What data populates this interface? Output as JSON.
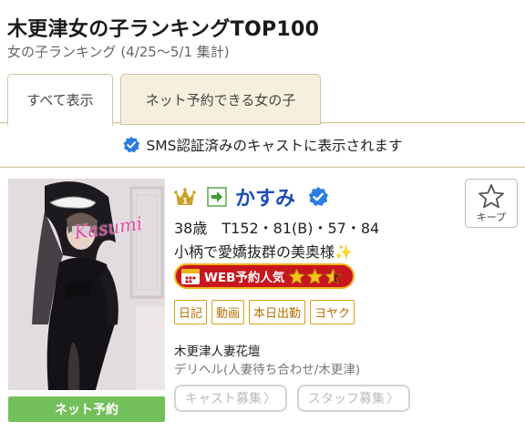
{
  "header": {
    "title": "木更津女の子ランキングTOP100",
    "subtitle": "女の子ランキング (4/25〜5/1 集計)"
  },
  "tabs": [
    {
      "label": "すべて表示",
      "active": true
    },
    {
      "label": "ネット予約できる女の子",
      "active": false
    }
  ],
  "notice": "SMS認証済みのキャストに表示されます",
  "cast": {
    "rank": 1,
    "name": "かすみ",
    "photo_signature": "Kasumi",
    "stats": "38歳　T152・81(B)・57・84",
    "catchphrase": "小柄で愛嬌抜群の美奥様",
    "sparkle": "✨",
    "web_badge": "WEB予約人気",
    "web_rating": 2.5,
    "tags": [
      "日記",
      "動画",
      "本日出勤",
      "ヨヤク"
    ],
    "shop_name": "木更津人妻花壇",
    "shop_type": "デリヘル(人妻待ち合わせ/木更津)",
    "keep_label": "キープ",
    "net_reserve_label": "ネット予約",
    "recruit_cast_label": "キャスト募集",
    "recruit_staff_label": "スタッフ募集",
    "chevron": "〉"
  },
  "colors": {
    "name": "#1d4eb8",
    "verified": "#2a7de1",
    "tab_band": "#faf3df",
    "tag_border": "#e09b1a",
    "badge_bg": "#c8161d",
    "badge_border": "#f2b21a",
    "net_reserve": "#73c05a"
  },
  "icons": [
    "verified-check-icon",
    "crown-rank-icon",
    "arrow-right-icon",
    "star-outline-icon",
    "calendar-icon",
    "star-icon",
    "sparkle-icon"
  ]
}
